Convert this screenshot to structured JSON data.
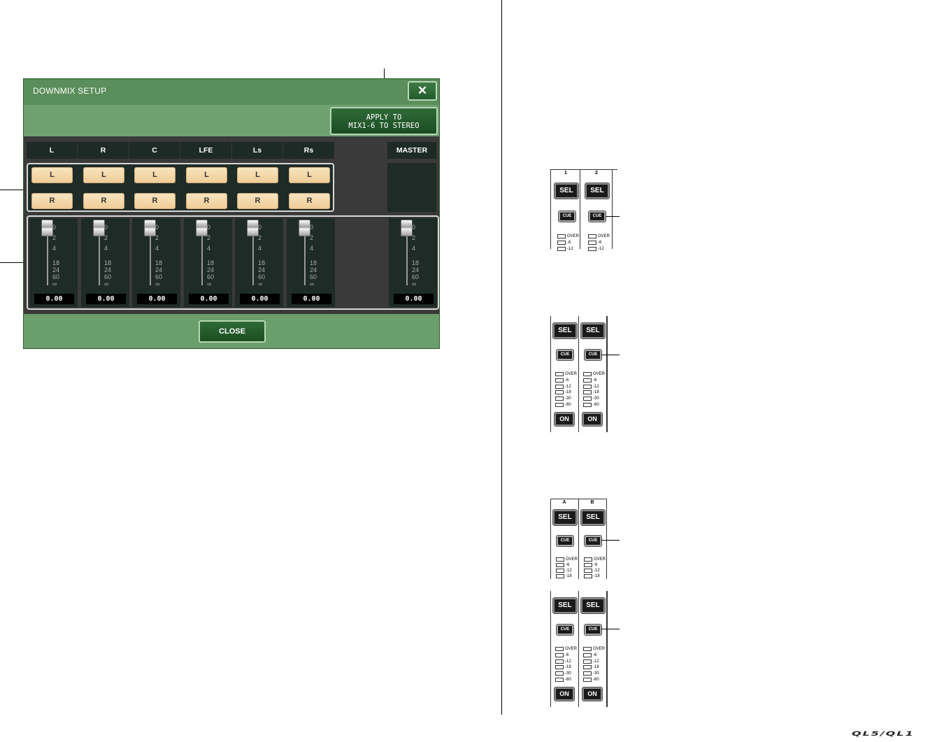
{
  "dialog": {
    "title": "DOWNMIX SETUP",
    "close_icon": "close-x-icon",
    "apply_button": {
      "line1": "APPLY TO",
      "line2": "MIX1-6 TO STEREO"
    },
    "channels": [
      {
        "name": "L",
        "route_l": "L",
        "route_r": "R",
        "value": "0.00"
      },
      {
        "name": "R",
        "route_l": "L",
        "route_r": "R",
        "value": "0.00"
      },
      {
        "name": "C",
        "route_l": "L",
        "route_r": "R",
        "value": "0.00"
      },
      {
        "name": "LFE",
        "route_l": "L",
        "route_r": "R",
        "value": "0.00"
      },
      {
        "name": "Ls",
        "route_l": "L",
        "route_r": "R",
        "value": "0.00"
      },
      {
        "name": "Rs",
        "route_l": "L",
        "route_r": "R",
        "value": "0.00"
      }
    ],
    "master": {
      "name": "MASTER",
      "value": "0.00"
    },
    "fader_scale": [
      "0",
      "2",
      "4",
      "18",
      "24",
      "60",
      "∞"
    ],
    "close_button": "CLOSE"
  },
  "strips": {
    "block1": {
      "channels": [
        "1",
        "2"
      ],
      "sel": "SEL",
      "cue": "CUE",
      "meter": [
        "OVER",
        "-6",
        "-12"
      ]
    },
    "block2": {
      "sel": "SEL",
      "cue": "CUE",
      "meter": [
        "OVER",
        "-6",
        "-12",
        "-18",
        "-30",
        "-60"
      ],
      "on": "ON"
    },
    "block3": {
      "channels": [
        "A",
        "B"
      ],
      "sel": "SEL",
      "cue": "CUE",
      "meter": [
        "OVER",
        "-6",
        "-12",
        "-18"
      ]
    },
    "block4": {
      "sel": "SEL",
      "cue": "CUE",
      "meter": [
        "OVER",
        "-6",
        "-12",
        "-18",
        "-30",
        "-60"
      ],
      "on": "ON"
    }
  },
  "footer_logo": "QL5/QL1"
}
